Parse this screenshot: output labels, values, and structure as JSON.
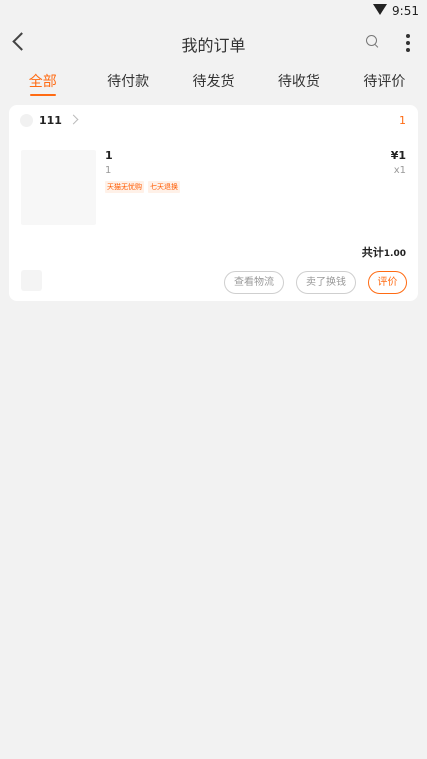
{
  "status_bar": {
    "time": "9:51",
    "wifi_icon": "wifi-icon"
  },
  "header": {
    "title": "我的订单",
    "back_icon": "back-arrow-icon",
    "search_icon": "search-icon",
    "more_icon": "more-vertical-icon"
  },
  "tabs": [
    {
      "label": "全部",
      "active": true
    },
    {
      "label": "待付款",
      "active": false
    },
    {
      "label": "待发货",
      "active": false
    },
    {
      "label": "待收货",
      "active": false
    },
    {
      "label": "待评价",
      "active": false
    }
  ],
  "order": {
    "store_name": "111",
    "status": "1",
    "item": {
      "title": "1",
      "spec": "1",
      "tags": [
        "天猫无忧购",
        "七天退换"
      ],
      "price": "¥1",
      "quantity": "x1"
    },
    "total_label": "共计",
    "total_value": "1.00",
    "buttons": {
      "logistics": "查看物流",
      "resell": "卖了换钱",
      "review": "评价"
    }
  },
  "colors": {
    "accent": "#ff6b13",
    "background": "#f2f2f2"
  }
}
